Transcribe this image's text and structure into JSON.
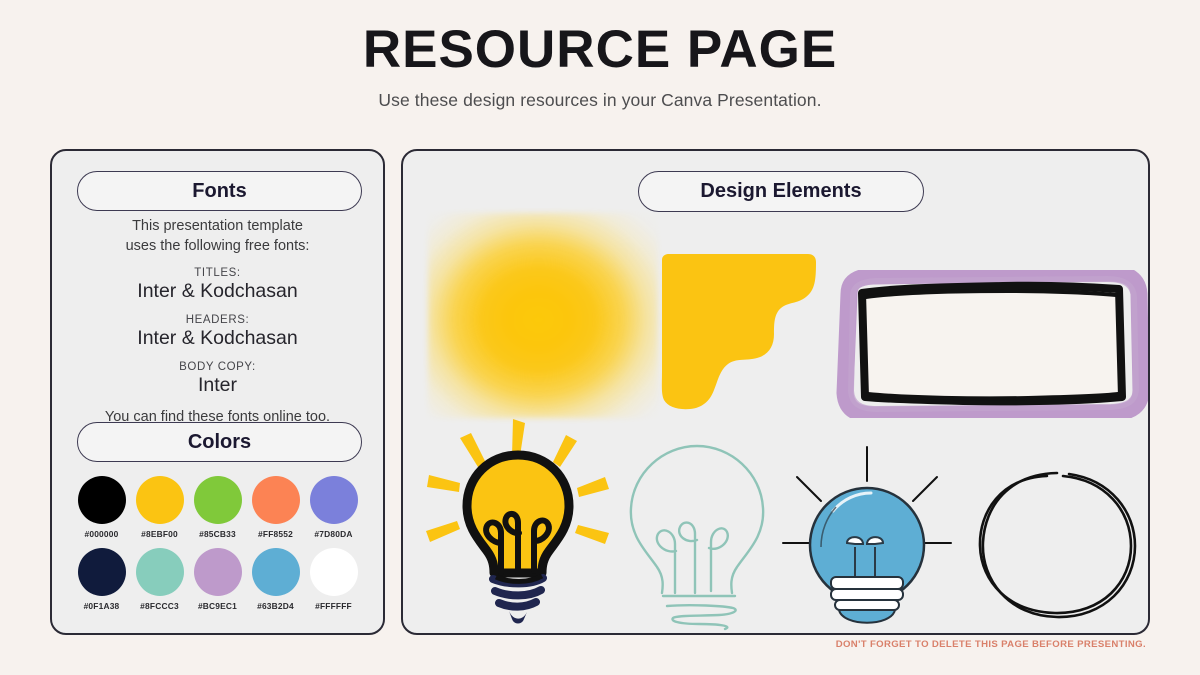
{
  "header": {
    "title": "RESOURCE PAGE",
    "subtitle": "Use these design resources in your Canva Presentation."
  },
  "fonts_panel": {
    "heading": "Fonts",
    "intro_line1": "This presentation template",
    "intro_line2": "uses the following free fonts:",
    "groups": [
      {
        "label": "TITLES:",
        "value": "Inter & Kodchasan"
      },
      {
        "label": "HEADERS:",
        "value": "Inter & Kodchasan"
      },
      {
        "label": "BODY COPY:",
        "value": "Inter"
      }
    ],
    "outro": "You can find these fonts online too."
  },
  "colors_panel": {
    "heading": "Colors",
    "swatches": [
      {
        "hex": "#000000",
        "display": "#000000"
      },
      {
        "hex": "#8EBF00",
        "display": "#FBC412"
      },
      {
        "hex": "#85CB33",
        "display": "#80C93A"
      },
      {
        "hex": "#FF8552",
        "display": "#FC8354"
      },
      {
        "hex": "#7D80DA",
        "display": "#7B80DB"
      },
      {
        "hex": "#0F1A38",
        "display": "#101B3C"
      },
      {
        "hex": "#8FCCC3",
        "display": "#87CDBC"
      },
      {
        "hex": "#BC9EC1",
        "display": "#BE9ACB"
      },
      {
        "hex": "#63B2D4",
        "display": "#5EAED4"
      },
      {
        "hex": "#FFFFFF",
        "display": "#FFFFFF"
      }
    ]
  },
  "design_panel": {
    "heading": "Design Elements",
    "elements": [
      {
        "name": "sun-glow",
        "type": "radial-gradient",
        "color": "#FBC412"
      },
      {
        "name": "yellow-blob",
        "type": "shape",
        "color": "#FBC412"
      },
      {
        "name": "purple-black-frame",
        "type": "frame",
        "outer_color": "#BE9ACB",
        "inner_color": "#111111",
        "fill": "#F7F3EF"
      },
      {
        "name": "lightbulb-filled-yellow",
        "type": "illustration",
        "color": "#FBC412"
      },
      {
        "name": "lightbulb-outline-teal",
        "type": "illustration",
        "color": "#8FC4B8"
      },
      {
        "name": "lightbulb-filled-blue",
        "type": "illustration",
        "color": "#5EAED4"
      },
      {
        "name": "sketch-circle",
        "type": "illustration",
        "color": "#111111"
      }
    ]
  },
  "footer": {
    "note": "DON'T FORGET TO DELETE THIS PAGE BEFORE PRESENTING.",
    "note_color": "#D9806A"
  }
}
